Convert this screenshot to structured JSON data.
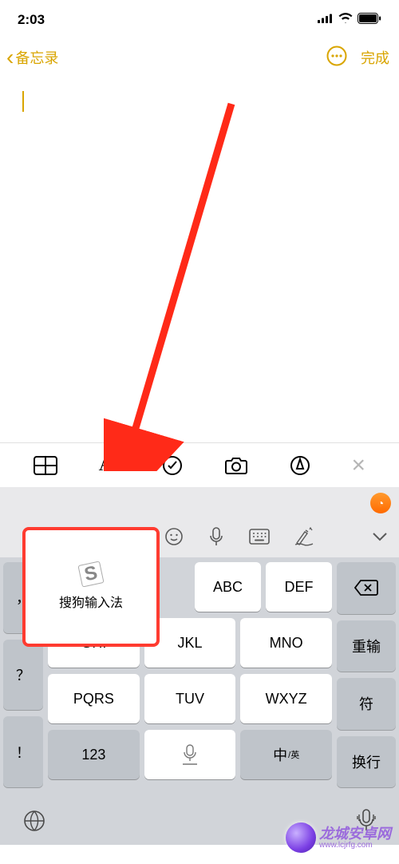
{
  "status": {
    "time": "2:03"
  },
  "nav": {
    "back": "备忘录",
    "done": "完成"
  },
  "sogou": {
    "label": "搜狗输入法",
    "icon_letter": "S"
  },
  "keys": {
    "abc": "ABC",
    "def": "DEF",
    "ghi": "GHI",
    "jkl": "JKL",
    "mno": "MNO",
    "pqrs": "PQRS",
    "tuv": "TUV",
    "wxyz": "WXYZ",
    "num": "123",
    "zhong": "中",
    "ying": "/英",
    "side_comma": "，",
    "side_q": "？",
    "side_ex": "！",
    "reinput": "重输",
    "symbol": "符",
    "enter": "换行"
  },
  "watermark": {
    "brand": "龙城安卓网",
    "url": "www.lcjrfg.com"
  }
}
